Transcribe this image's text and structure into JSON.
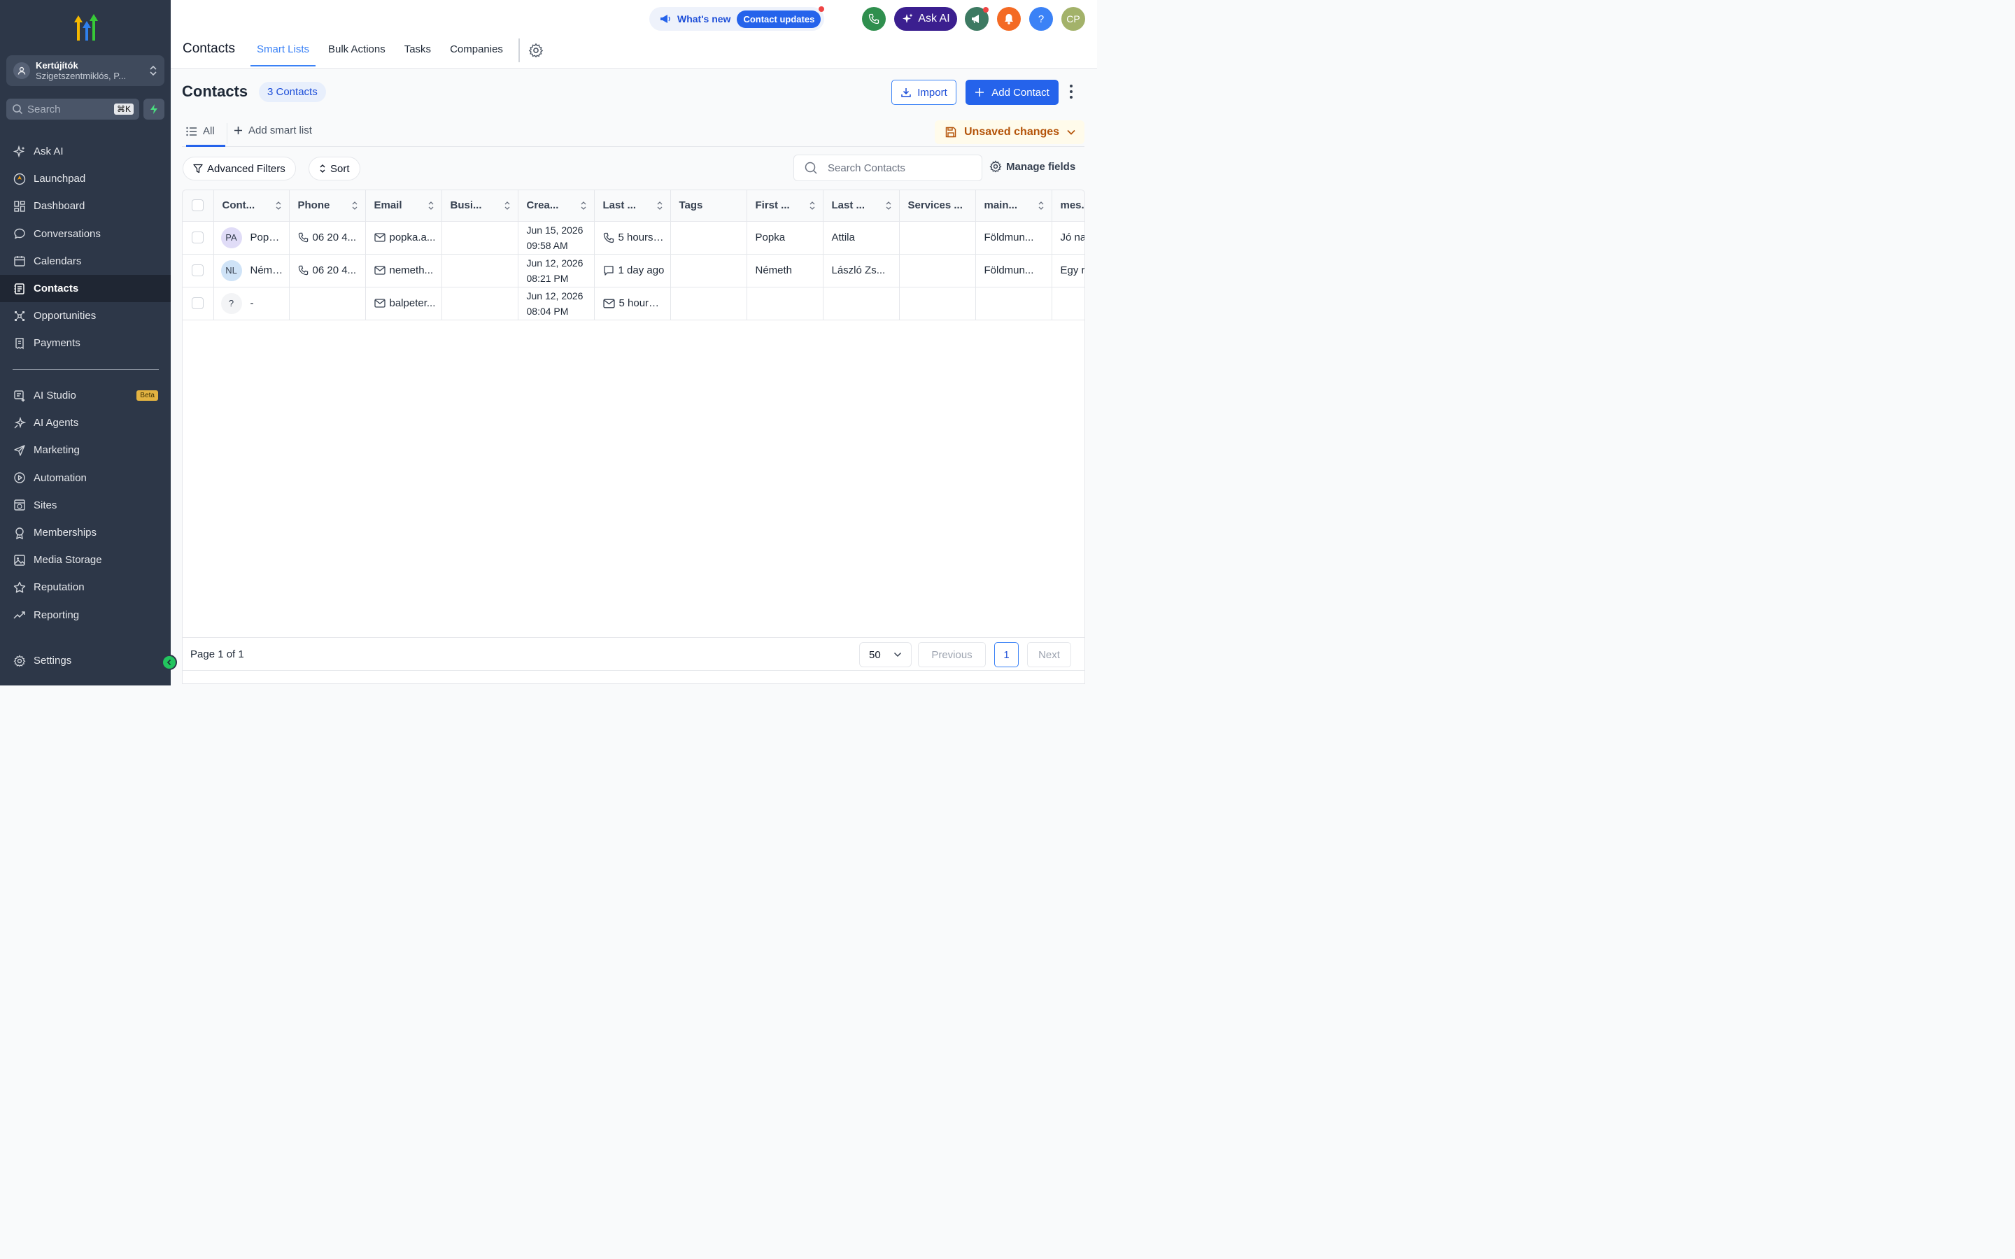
{
  "sidebar": {
    "account": {
      "name": "Kertújítók",
      "location": "Szigetszentmiklós, P..."
    },
    "search": {
      "label": "Search",
      "shortcut": "⌘K"
    },
    "nav_primary": [
      {
        "label": "Ask AI",
        "icon": "sparkles-icon"
      },
      {
        "label": "Launchpad",
        "icon": "launchpad-icon"
      },
      {
        "label": "Dashboard",
        "icon": "dashboard-grid-icon"
      },
      {
        "label": "Conversations",
        "icon": "chat-bubble-icon"
      },
      {
        "label": "Calendars",
        "icon": "calendar-icon"
      },
      {
        "label": "Contacts",
        "icon": "contact-book-icon",
        "active": true
      },
      {
        "label": "Opportunities",
        "icon": "opportunities-icon"
      },
      {
        "label": "Payments",
        "icon": "receipt-icon"
      }
    ],
    "nav_secondary": [
      {
        "label": "AI Studio",
        "icon": "ai-studio-icon",
        "badge": "Beta"
      },
      {
        "label": "AI Agents",
        "icon": "ai-agents-icon"
      },
      {
        "label": "Marketing",
        "icon": "send-icon"
      },
      {
        "label": "Automation",
        "icon": "automation-icon"
      },
      {
        "label": "Sites",
        "icon": "globe-icon"
      },
      {
        "label": "Memberships",
        "icon": "award-icon"
      },
      {
        "label": "Media Storage",
        "icon": "image-icon"
      },
      {
        "label": "Reputation",
        "icon": "star-icon"
      },
      {
        "label": "Reporting",
        "icon": "trend-icon"
      }
    ],
    "settings_label": "Settings"
  },
  "topbar": {
    "whats_new": "What's new",
    "contact_updates": "Contact updates",
    "ask_ai": "Ask AI",
    "user_initials": "CP",
    "help": "?",
    "section_title": "Contacts",
    "tabs": [
      "Smart Lists",
      "Bulk Actions",
      "Tasks",
      "Companies"
    ]
  },
  "main": {
    "title": "Contacts",
    "count": "3 Contacts",
    "import_label": "Import",
    "add_contact_label": "Add Contact",
    "subtab_all": "All",
    "add_smart_list": "Add smart list",
    "unsaved": "Unsaved changes",
    "advanced_filters": "Advanced Filters",
    "sort": "Sort",
    "search_placeholder": "Search Contacts",
    "manage_fields": "Manage fields"
  },
  "table": {
    "columns": [
      "Cont...",
      "Phone",
      "Email",
      "Busi...",
      "Crea...",
      "Last ...",
      "Tags",
      "First ...",
      "Last ...",
      "Services ...",
      "main...",
      "mes..."
    ],
    "rows": [
      {
        "initials": "PA",
        "avatar_color": "#e0dcf7",
        "name": "Popka ...",
        "phone": "06 20 4...",
        "email": "popka.a...",
        "business": "",
        "created_date": "Jun 15, 2026",
        "created_time": "09:58 AM",
        "last_icon": "phone-icon",
        "last": "5 hours ...",
        "tags": "",
        "first_name": "Popka",
        "last_name": "Attila",
        "services": "",
        "main": "Földmun...",
        "mes": "Jó na..."
      },
      {
        "initials": "NL",
        "avatar_color": "#cfe3f7",
        "name": "Németh...",
        "phone": "06 20 4...",
        "email": "nemeth...",
        "business": "",
        "created_date": "Jun 12, 2026",
        "created_time": "08:21 PM",
        "last_icon": "message-icon",
        "last": "1 day ago",
        "tags": "",
        "first_name": "Németh",
        "last_name": "László Zs...",
        "services": "",
        "main": "Földmun...",
        "mes": "Egy r..."
      },
      {
        "initials": "?",
        "avatar_color": "#f3f4f6",
        "name": "-",
        "phone": "",
        "email": "balpeter...",
        "business": "",
        "created_date": "Jun 12, 2026",
        "created_time": "08:04 PM",
        "last_icon": "mail-icon",
        "last": "5 hours ...",
        "tags": "",
        "first_name": "",
        "last_name": "",
        "services": "",
        "main": "",
        "mes": ""
      }
    ]
  },
  "pagination": {
    "page_text": "Page 1 of 1",
    "per_page": "50",
    "previous": "Previous",
    "current": "1",
    "next": "Next"
  }
}
